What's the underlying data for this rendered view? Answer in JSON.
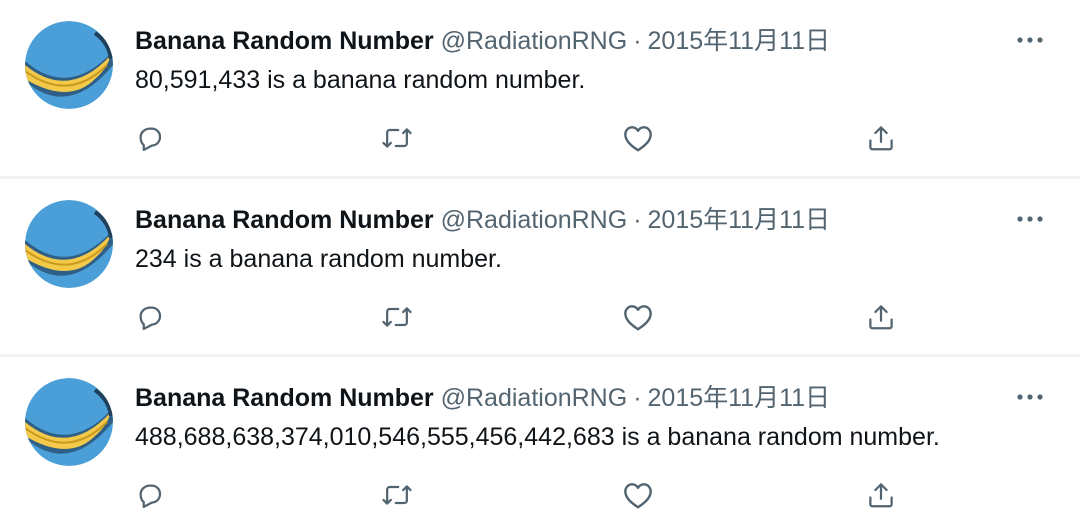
{
  "tweets": [
    {
      "author_name": "Banana Random Number",
      "handle": "@RadiationRNG",
      "separator": "·",
      "date": "2015年11月11日",
      "text": "80,591,433 is a banana random number."
    },
    {
      "author_name": "Banana Random Number",
      "handle": "@RadiationRNG",
      "separator": "·",
      "date": "2015年11月11日",
      "text": "234 is a banana random number."
    },
    {
      "author_name": "Banana Random Number",
      "handle": "@RadiationRNG",
      "separator": "·",
      "date": "2015年11月11日",
      "text": "488,688,638,374,010,546,555,456,442,683 is a banana random number."
    }
  ],
  "icons": {
    "more": "more-horizontal-icon",
    "reply": "reply-icon",
    "retweet": "retweet-icon",
    "like": "heart-icon",
    "share": "share-icon",
    "avatar": "banana-avatar"
  },
  "colors": {
    "text_primary": "#0f1419",
    "text_secondary": "#536471",
    "divider": "#eff3f4",
    "avatar_sky": "#4a9fd8",
    "avatar_banana": "#f3c94a"
  }
}
